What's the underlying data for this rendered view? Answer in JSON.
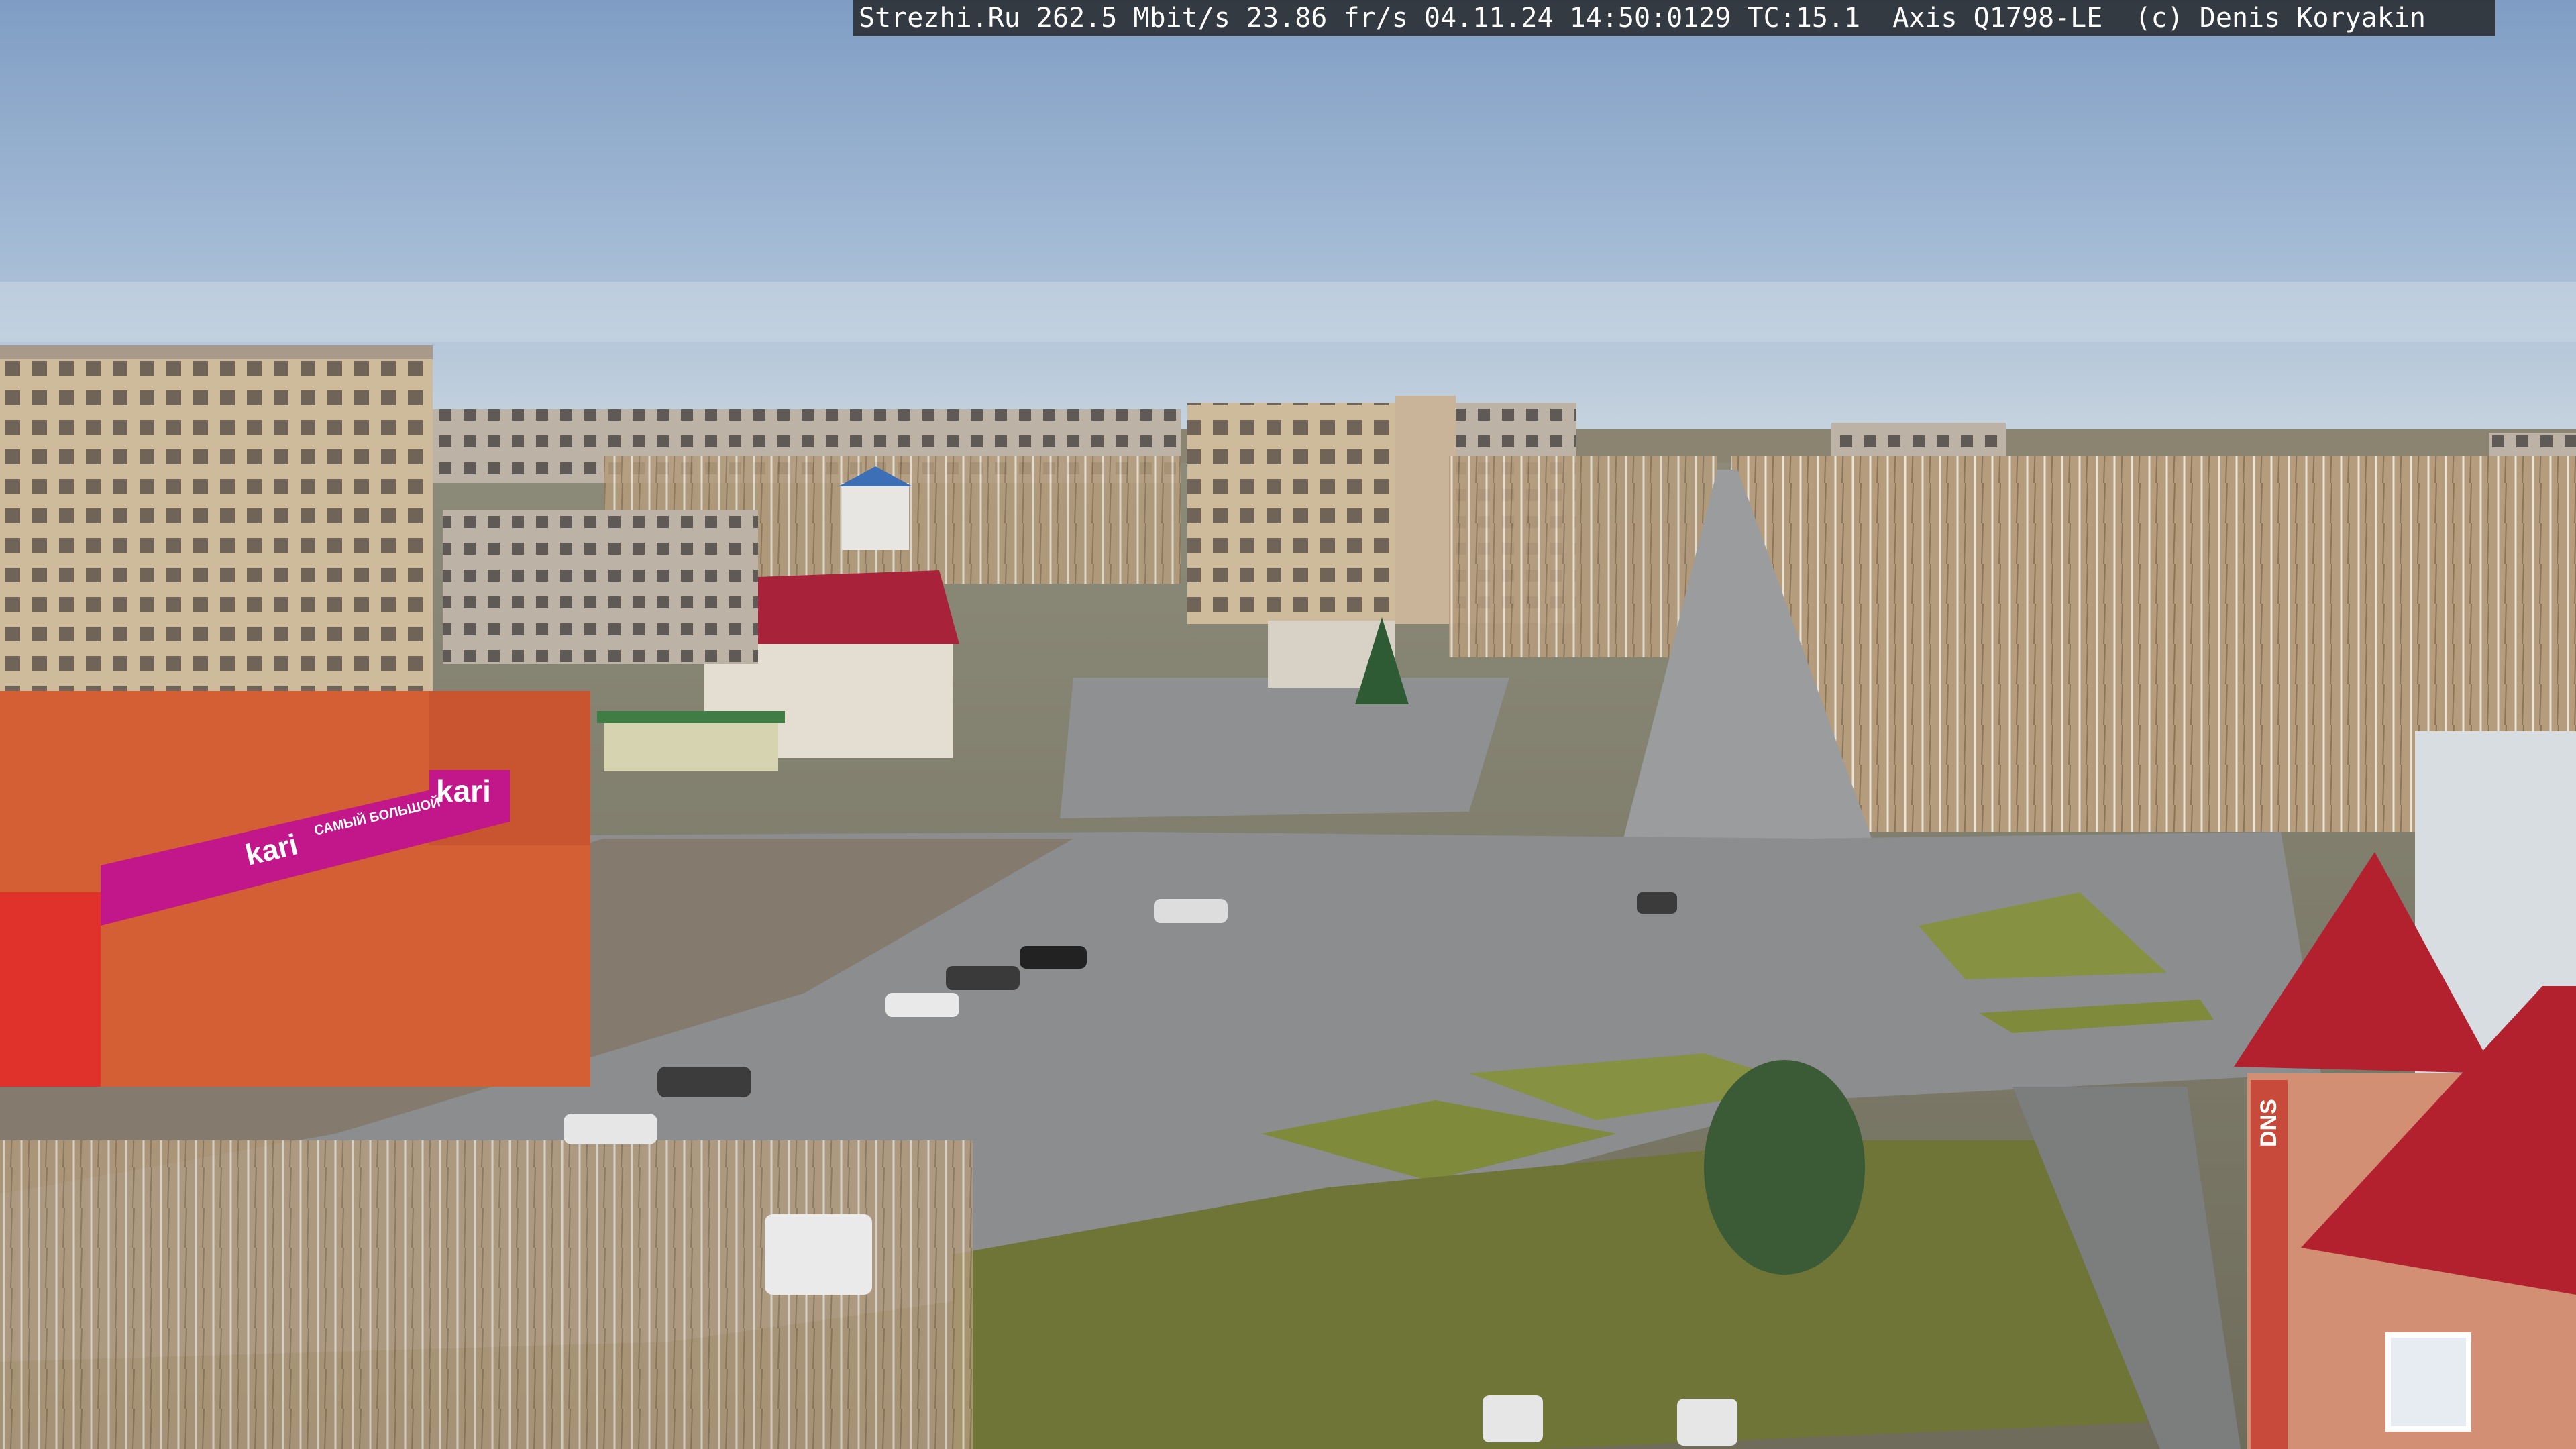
{
  "camera_overlay": {
    "text": "Strezhi.Ru 262.5 Mbit/s 23.86 fr/s 04.11.24 14:50:0129 TC:15.1  Axis Q1798-LE  (c) Denis Koryakin"
  },
  "storefront": {
    "brand_sign_main": "kari",
    "brand_sign_banner": "kari",
    "brand_banner_text": "САМЫЙ БОЛЬШОЙ",
    "corner_sign_right": "DNS"
  },
  "colors": {
    "sky_top": "#7f9dc4",
    "sky_horizon": "#c8d4df",
    "asphalt": "#8b8d8f",
    "kari_magenta": "#c1178a",
    "roof_red": "#b3212f",
    "grass": "#7f8a3a"
  }
}
